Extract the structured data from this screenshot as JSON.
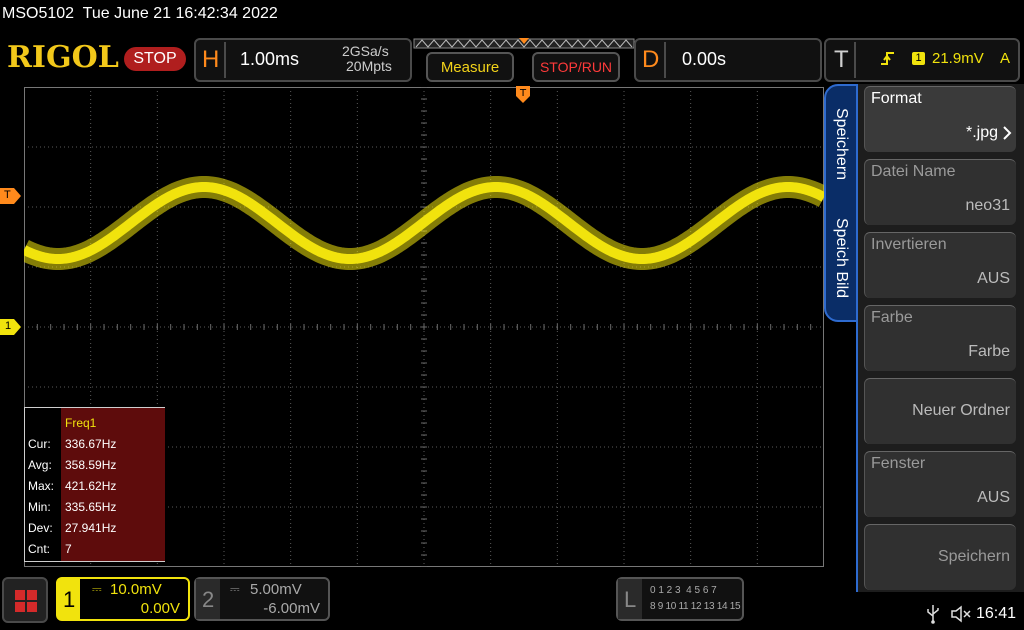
{
  "header": {
    "status_line": "MSO5102  Tue June 21 16:42:34 2022",
    "logo": "RIGOL",
    "run_state": "STOP",
    "horizontal": {
      "letter": "H",
      "timebase": "1.00ms",
      "sample_rate": "2GSa/s",
      "memory_depth": "20Mpts"
    },
    "measure_button": "Measure",
    "stop_run_button": "STOP/RUN",
    "delay": {
      "letter": "D",
      "value": "0.00s"
    },
    "trigger": {
      "letter": "T",
      "source": "1",
      "level": "21.9mV",
      "coupling": "A"
    }
  },
  "markers": {
    "trigger_level": "T",
    "channel1_ground": "1"
  },
  "side_tabs": {
    "save": "Speichern",
    "save_image": "Speich Bild"
  },
  "menu": [
    {
      "label": "Format",
      "value": "*.jpg",
      "enabled": true,
      "arrow": true
    },
    {
      "label": "Datei Name",
      "value": "neo31",
      "enabled": false
    },
    {
      "label": "Invertieren",
      "value": "AUS",
      "enabled": false
    },
    {
      "label": "Farbe",
      "value": "Farbe",
      "enabled": false
    },
    {
      "label": "",
      "value": "Neuer Ordner",
      "enabled": false
    },
    {
      "label": "Fenster",
      "value": "AUS",
      "enabled": false
    },
    {
      "label": "",
      "value": "Speichern",
      "enabled": false
    }
  ],
  "measurement": {
    "title": "Freq1",
    "rows": [
      {
        "label": "Cur:",
        "value": "336.67Hz"
      },
      {
        "label": "Avg:",
        "value": "358.59Hz"
      },
      {
        "label": "Max:",
        "value": "421.62Hz"
      },
      {
        "label": "Min:",
        "value": "335.65Hz"
      },
      {
        "label": "Dev:",
        "value": "27.941Hz"
      },
      {
        "label": "Cnt:",
        "value": "7"
      }
    ]
  },
  "channels": [
    {
      "number": "1",
      "scale": "10.0mV",
      "offset": "0.00V",
      "color": "#f1e30d"
    },
    {
      "number": "2",
      "scale": "5.00mV",
      "offset": "-6.00mV",
      "color": "#aaaaaa"
    }
  ],
  "logic": {
    "letter": "L",
    "row1": "0 1 2 3  4 5 6 7",
    "row2": "8 9 10 11 12 13 14 15"
  },
  "statusbar": {
    "time": "16:41"
  },
  "colors": {
    "waveform": "#f1e30d",
    "accent": "#ff8a1c",
    "menu_tab": "#0a2d67"
  }
}
